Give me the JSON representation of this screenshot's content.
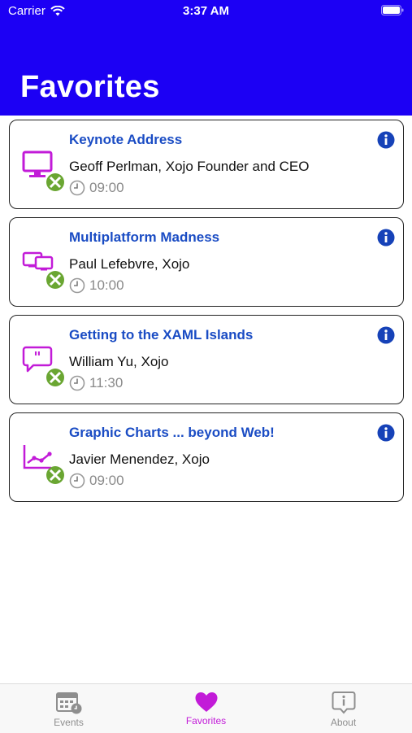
{
  "status_bar": {
    "carrier": "Carrier",
    "time": "3:37 AM"
  },
  "header": {
    "title": "Favorites"
  },
  "colors": {
    "header_bg": "#1c00f4",
    "accent": "#c21bd8",
    "title_blue": "#1a4cc4",
    "info_blue": "#1642b8",
    "favorite_green": "#6aa632"
  },
  "sessions": [
    {
      "title": "Keynote Address",
      "speaker": "Geoff Perlman, Xojo Founder and CEO",
      "time": "09:00",
      "icon": "monitor-icon"
    },
    {
      "title": "Multiplatform Madness",
      "speaker": "Paul Lefebvre, Xojo",
      "time": "10:00",
      "icon": "multi-device-icon"
    },
    {
      "title": "Getting to the XAML Islands",
      "speaker": "William Yu, Xojo",
      "time": "11:30",
      "icon": "quote-bubble-icon"
    },
    {
      "title": "Graphic Charts ... beyond Web!",
      "speaker": "Javier Menendez, Xojo",
      "time": "09:00",
      "icon": "line-chart-icon"
    }
  ],
  "tabbar": {
    "tabs": [
      {
        "label": "Events",
        "icon": "calendar-clock-icon"
      },
      {
        "label": "Favorites",
        "icon": "heart-icon",
        "active": true
      },
      {
        "label": "About",
        "icon": "info-bubble-icon"
      }
    ]
  }
}
